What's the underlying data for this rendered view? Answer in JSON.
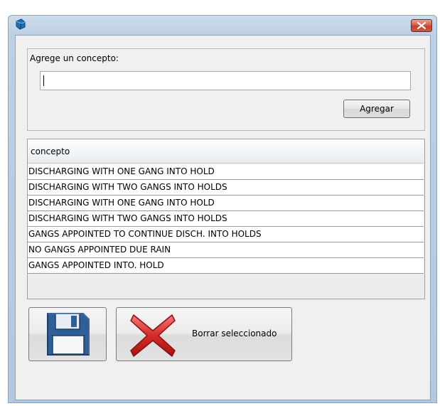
{
  "window": {
    "title": "",
    "icons": {
      "app": "app-icon",
      "close": "close-icon"
    }
  },
  "concept_group": {
    "label": "Agrege un concepto:",
    "input_value": "",
    "add_button_label": "Agregar"
  },
  "grid": {
    "columns": [
      "concepto"
    ],
    "rows": [
      "DISCHARGING WITH ONE GANG INTO HOLD",
      "DISCHARGING WITH TWO GANGS INTO HOLDS",
      "DISCHARGING WITH ONE GANG INTO HOLD",
      "DISCHARGING WITH TWO GANGS INTO HOLDS",
      "GANGS APPOINTED TO CONTINUE DISCH. INTO HOLDS",
      "NO GANGS APPOINTED DUE RAIN",
      "GANGS APPOINTED INTO. HOLD"
    ]
  },
  "actions": {
    "save_icon": "floppy-disk-icon",
    "delete_icon": "red-x-icon",
    "delete_label": "Borrar seleccionado"
  }
}
